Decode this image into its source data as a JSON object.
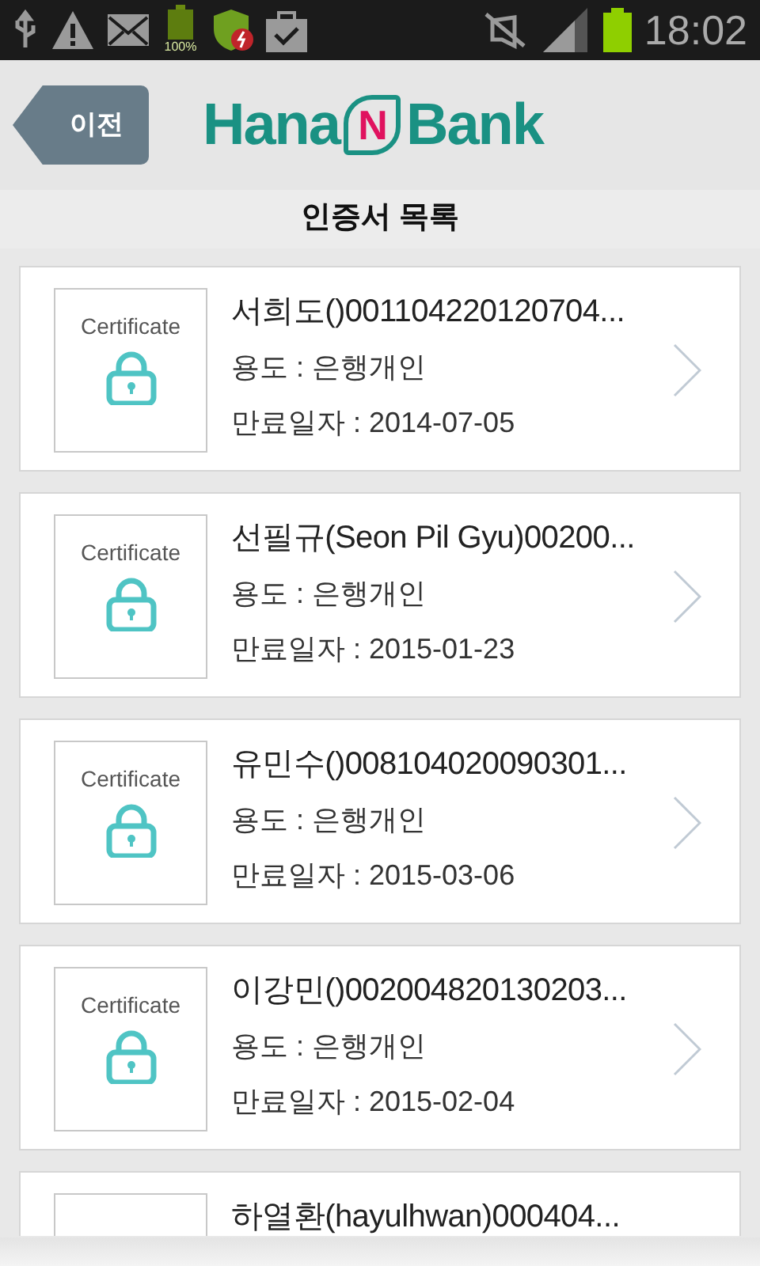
{
  "status_bar": {
    "battery_app_label": "100%",
    "time": "18:02"
  },
  "header": {
    "back_button": "이전",
    "logo": {
      "left": "Hana",
      "mark": "N",
      "right": "Bank"
    }
  },
  "title": "인증서 목록",
  "certificates": [
    {
      "cert_label": "Certificate",
      "name": "서희도()001104220120704...",
      "usage": "용도 : 은행개인",
      "expiry": "만료일자 : 2014-07-05"
    },
    {
      "cert_label": "Certificate",
      "name": "선필규(Seon Pil Gyu)00200...",
      "usage": "용도 : 은행개인",
      "expiry": "만료일자 : 2015-01-23"
    },
    {
      "cert_label": "Certificate",
      "name": "유민수()008104020090301...",
      "usage": "용도 : 은행개인",
      "expiry": "만료일자 : 2015-03-06"
    },
    {
      "cert_label": "Certificate",
      "name": "이강민()002004820130203...",
      "usage": "용도 : 은행개인",
      "expiry": "만료일자 : 2015-02-04"
    },
    {
      "name": "하열환(hayulhwan)000404..."
    }
  ]
}
